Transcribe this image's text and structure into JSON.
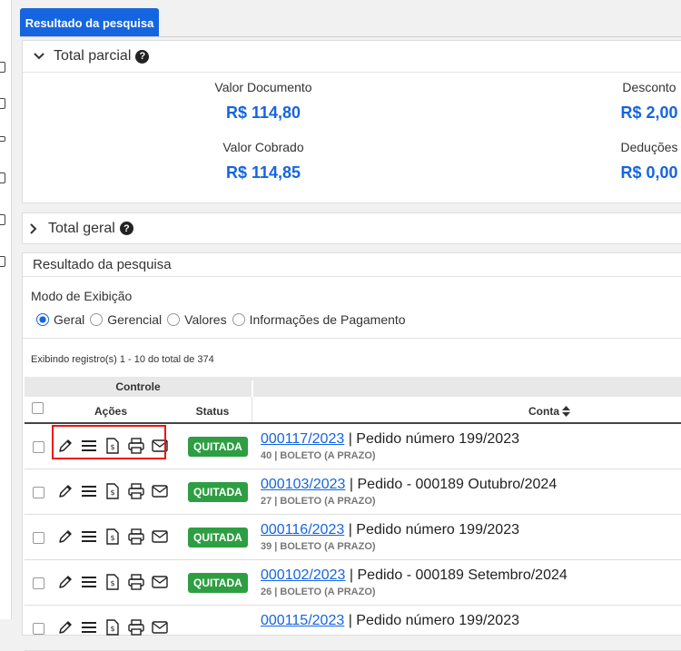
{
  "tab": {
    "label": "Resultado da pesquisa"
  },
  "parcial": {
    "title": "Total parcial",
    "valor_documento_label": "Valor Documento",
    "valor_documento": "R$ 114,80",
    "desconto_label": "Desconto",
    "desconto": "R$ 2,00",
    "valor_cobrado_label": "Valor Cobrado",
    "valor_cobrado": "R$ 114,85",
    "deducoes_label": "Deduções",
    "deducoes": "R$ 0,00"
  },
  "geral": {
    "title": "Total geral"
  },
  "resultado": {
    "title": "Resultado da pesquisa",
    "modo_label": "Modo de Exibição",
    "modes": [
      "Geral",
      "Gerencial",
      "Valores",
      "Informações de Pagamento"
    ],
    "selected_mode": "Geral",
    "exibindo": "Exibindo registro(s) 1 - 10 do total de 374",
    "header": {
      "controle": "Controle",
      "acoes": "Ações",
      "status": "Status",
      "conta": "Conta"
    },
    "rows": [
      {
        "numero": "000117/2023",
        "descricao": "| Pedido número 199/2023",
        "sub": "40 | BOLETO (A PRAZO)",
        "status": "QUITADA"
      },
      {
        "numero": "000103/2023",
        "descricao": "| Pedido - 000189 Outubro/2024",
        "sub": "27 | BOLETO (A PRAZO)",
        "status": "QUITADA"
      },
      {
        "numero": "000116/2023",
        "descricao": "| Pedido número 199/2023",
        "sub": "39 | BOLETO (A PRAZO)",
        "status": "QUITADA"
      },
      {
        "numero": "000102/2023",
        "descricao": "| Pedido - 000189 Setembro/2024",
        "sub": "26 | BOLETO (A PRAZO)",
        "status": "QUITADA"
      },
      {
        "numero": "000115/2023",
        "descricao": "| Pedido número 199/2023",
        "sub": "",
        "status": ""
      }
    ]
  },
  "colors": {
    "primary": "#1565e0",
    "success": "#2e9e43",
    "highlight": "#ee1111"
  }
}
